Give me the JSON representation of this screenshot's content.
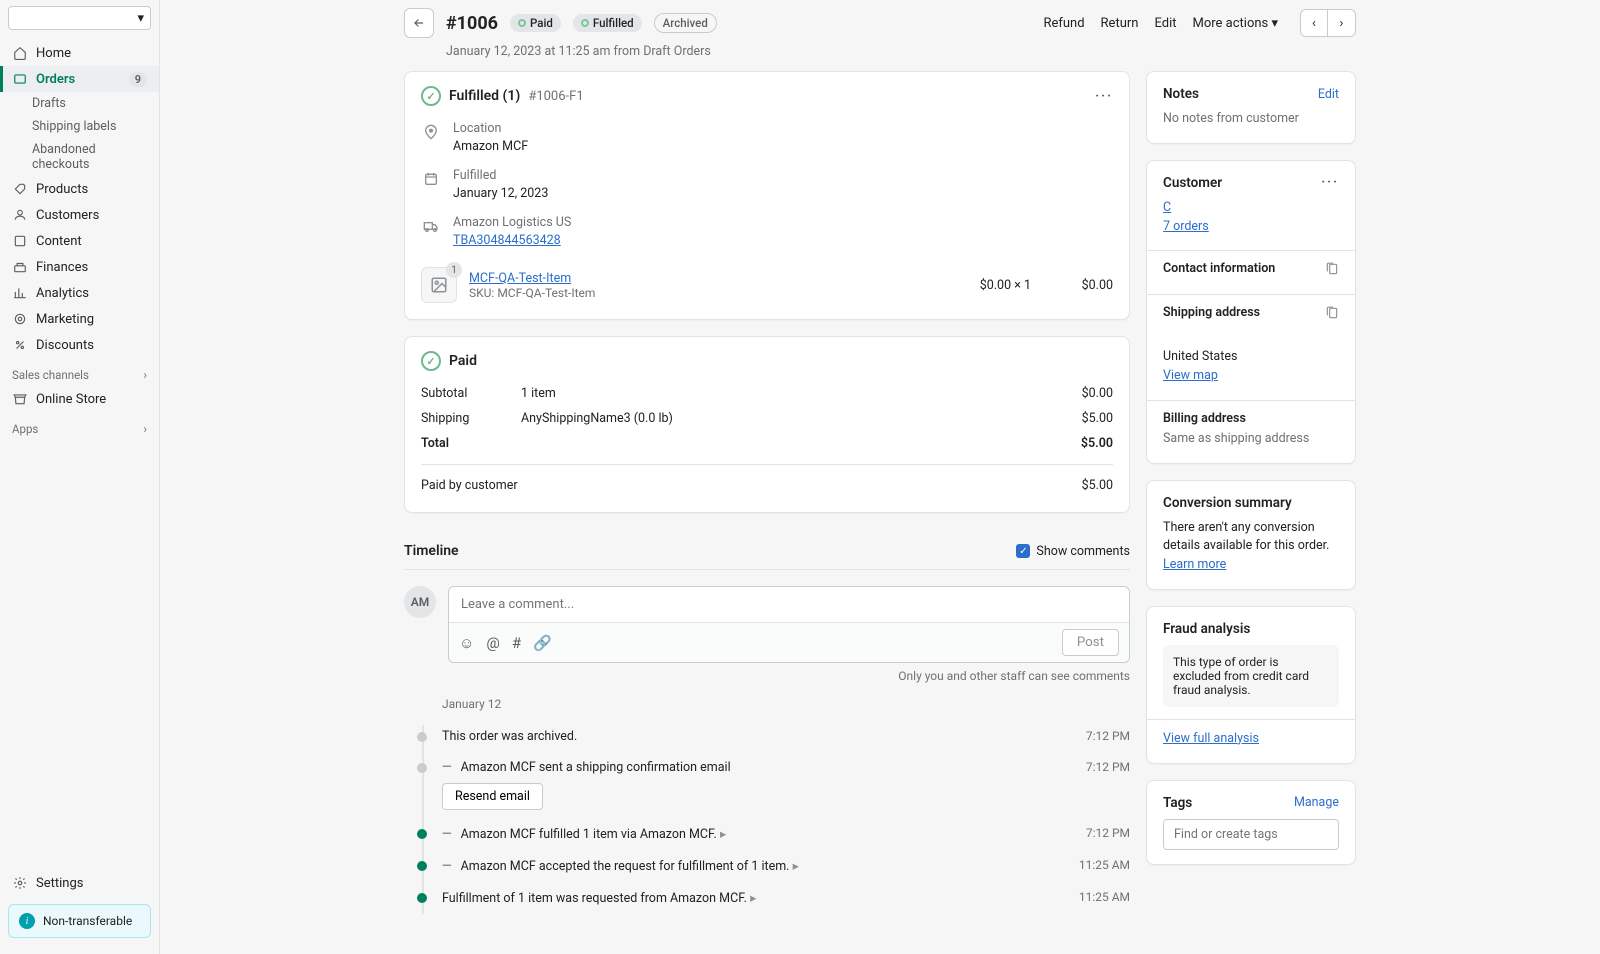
{
  "sidebar": {
    "items": [
      {
        "label": "Home"
      },
      {
        "label": "Orders",
        "badge": "9"
      },
      {
        "label": "Products"
      },
      {
        "label": "Customers"
      },
      {
        "label": "Content"
      },
      {
        "label": "Finances"
      },
      {
        "label": "Analytics"
      },
      {
        "label": "Marketing"
      },
      {
        "label": "Discounts"
      }
    ],
    "orders_sub": [
      "Drafts",
      "Shipping labels",
      "Abandoned checkouts"
    ],
    "channels_heading": "Sales channels",
    "channels": [
      "Online Store"
    ],
    "apps_heading": "Apps",
    "settings": "Settings",
    "footer_badge": "Non-transferable"
  },
  "header": {
    "order_number": "#1006",
    "paid_pill": "Paid",
    "fulfilled_pill": "Fulfilled",
    "archived_pill": "Archived",
    "actions": {
      "refund": "Refund",
      "return": "Return",
      "edit": "Edit",
      "more": "More actions"
    },
    "subtitle": "January 12, 2023 at 11:25 am from Draft Orders"
  },
  "fulfillment": {
    "title": "Fulfilled (1)",
    "ref": "#1006-F1",
    "location_label": "Location",
    "location_value": "Amazon MCF",
    "fulfilled_label": "Fulfilled",
    "fulfilled_date": "January 12, 2023",
    "carrier": "Amazon Logistics US",
    "tracking": "TBA304844563428",
    "item": {
      "name": "MCF-QA-Test-Item",
      "sku": "SKU: MCF-QA-Test-Item",
      "qty": "$0.00 × 1",
      "price": "$0.00",
      "badge": "1"
    }
  },
  "paid": {
    "title": "Paid",
    "rows": [
      {
        "label": "Subtotal",
        "detail": "1 item",
        "amount": "$0.00"
      },
      {
        "label": "Shipping",
        "detail": "AnyShippingName3 (0.0 lb)",
        "amount": "$5.00"
      },
      {
        "label": "Total",
        "detail": "",
        "amount": "$5.00"
      }
    ],
    "paid_by": "Paid by customer",
    "paid_by_amount": "$5.00"
  },
  "timeline": {
    "title": "Timeline",
    "show_comments": "Show comments",
    "avatar": "AM",
    "placeholder": "Leave a comment...",
    "post": "Post",
    "note": "Only you and other staff can see comments",
    "date": "January 12",
    "events": [
      {
        "text": "This order was archived.",
        "time": "7:12 PM",
        "dot": "grey"
      },
      {
        "text": "Amazon MCF sent a shipping confirmation email",
        "time": "7:12 PM",
        "dot": "grey",
        "collapsible": true,
        "action": "Resend email"
      },
      {
        "text": "Amazon MCF fulfilled 1 item via Amazon MCF.",
        "time": "7:12 PM",
        "dot": "green",
        "collapsible": true,
        "caret": true
      },
      {
        "text": "Amazon MCF accepted the request for fulfillment of 1 item.",
        "time": "11:25 AM",
        "dot": "green",
        "collapsible": true,
        "caret": true
      },
      {
        "text": "Fulfillment of 1 item was requested from Amazon MCF.",
        "time": "11:25 AM",
        "dot": "green",
        "caret": true
      }
    ]
  },
  "notes": {
    "title": "Notes",
    "edit": "Edit",
    "body": "No notes from customer"
  },
  "customer": {
    "title": "Customer",
    "name": "C",
    "orders": "7 orders",
    "contact_title": "Contact information",
    "shipping_title": "Shipping address",
    "country": "United States",
    "view_map": "View map",
    "billing_title": "Billing address",
    "billing_body": "Same as shipping address"
  },
  "conversion": {
    "title": "Conversion summary",
    "body": "There aren't any conversion details available for this order.",
    "learn": "Learn more"
  },
  "fraud": {
    "title": "Fraud analysis",
    "box": "This type of order is excluded from credit card fraud analysis.",
    "link": "View full analysis"
  },
  "tags": {
    "title": "Tags",
    "manage": "Manage",
    "placeholder": "Find or create tags"
  }
}
